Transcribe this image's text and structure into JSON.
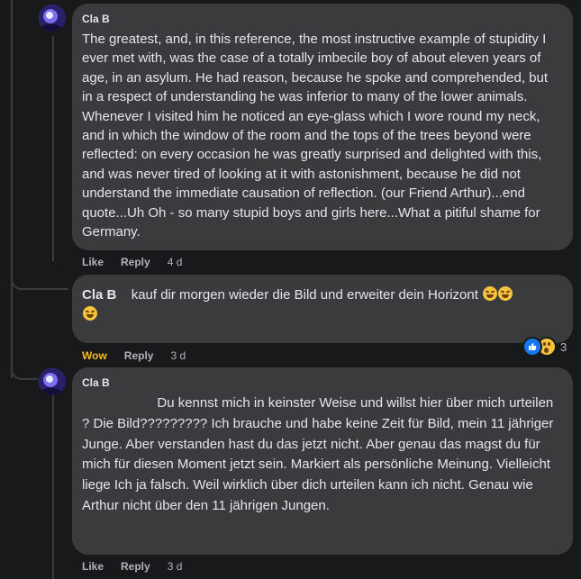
{
  "comments": [
    {
      "author": "Cla B",
      "text": "The greatest, and, in this reference, the most instructive example of stupidity I ever met with, was the case of a totally imbecile boy of about eleven years of age, in an asylum. He had reason, because he spoke and comprehended, but in a respect of understanding he was inferior to many of the lower animals. Whenever I visited him he noticed an eye-glass which I wore round my neck, and in which the window of the room and the tops of the trees beyond were reflected: on every occasion he was greatly surprised and delighted with this, and was never tired of looking at it with astonishment, because he did not understand the immediate causation of reflection. (our Friend Arthur)...end quote...Uh Oh - so many stupid boys and girls here...What a pitiful shame for Germany.",
      "actions": {
        "like": "Like",
        "reply": "Reply",
        "time": "4 d"
      }
    },
    {
      "author": "Cla B",
      "text": "kauf dir morgen wieder die Bild und erweiter dein Horizont",
      "emoji_icons": [
        "rofl-emoji-icon",
        "rofl-emoji-icon",
        "rofl-emoji-icon"
      ],
      "actions": {
        "like": "Wow",
        "reply": "Reply",
        "time": "3 d"
      },
      "reactions": {
        "icons": [
          "like-reaction-icon",
          "wow-reaction-icon"
        ],
        "count": "3"
      }
    },
    {
      "author": "Cla B",
      "text": "                    Du kennst mich in keinster Weise und willst hier über mich urteilen ? Die Bild????????? Ich brauche und habe keine Zeit für Bild, mein 11 jähriger Junge. Aber verstanden hast du das jetzt nicht. Aber genau das magst du für mich für diesen Moment jetzt sein. Markiert als persönliche Meinung. Vielleicht liege Ich ja falsch. Weil wirklich über dich urteilen kann ich nicht. Genau wie Arthur nicht über den 11 jährigen Jungen.",
      "actions": {
        "like": "Like",
        "reply": "Reply",
        "time": "3 d"
      }
    }
  ],
  "colors": {
    "background": "#18191a",
    "bubble": "#3a3b3c",
    "text": "#e4e6eb",
    "muted": "#b0b3b8",
    "wow": "#f7b928",
    "like_blue": "#1877f2"
  }
}
